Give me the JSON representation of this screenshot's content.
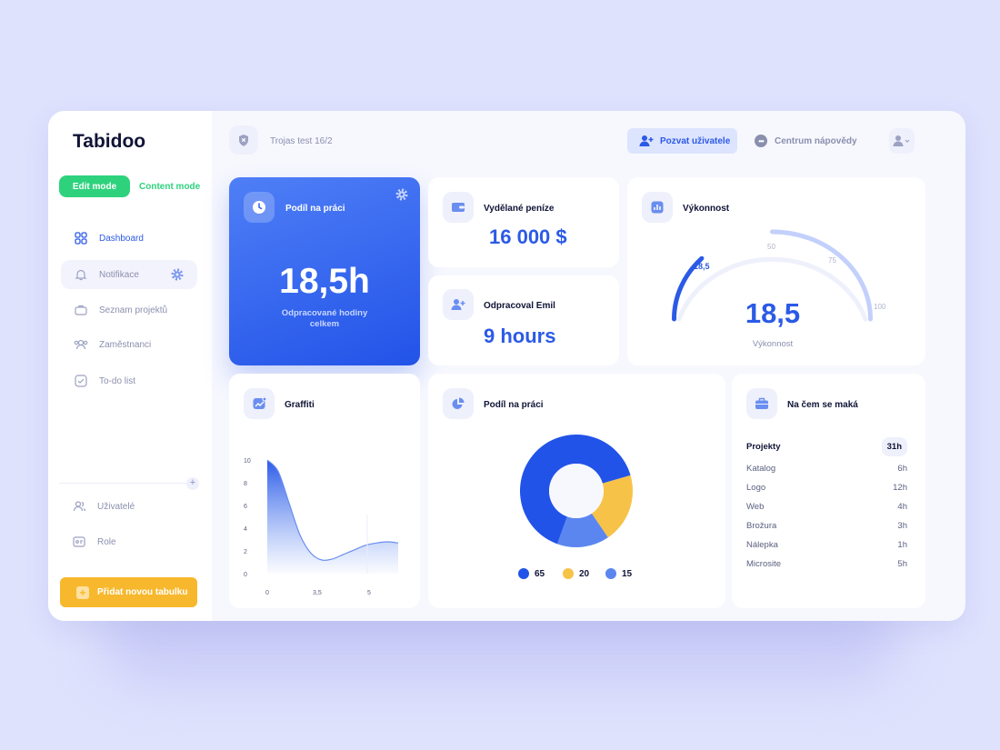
{
  "app": {
    "name": "Tabidoo"
  },
  "modes": {
    "edit": "Edit mode",
    "content": "Content mode"
  },
  "sidebar": {
    "items": [
      {
        "label": "Dashboard"
      },
      {
        "label": "Notifikace"
      },
      {
        "label": "Seznam projektů"
      },
      {
        "label": "Zaměstnanci"
      },
      {
        "label": "To-do list"
      }
    ],
    "bottom_items": [
      {
        "label": "Uživatelé"
      },
      {
        "label": "Role"
      }
    ],
    "add_table": "Přidat novou tabulku"
  },
  "topbar": {
    "workspace": "Trojas test 16/2",
    "invite": "Pozvat uživatele",
    "help": "Centrum nápovědy"
  },
  "cards": {
    "podil_hero": {
      "title": "Podíl na práci",
      "value": "18,5h",
      "subtitle": "Odpracované hodiny celkem"
    },
    "money": {
      "title": "Vydělané peníze",
      "value": "16 000 $"
    },
    "worked": {
      "title": "Odpracoval Emil",
      "value": "9 hours"
    },
    "performance": {
      "title": "Výkonnost",
      "value": "18,5",
      "label": "Výkonnost",
      "current": 18.5,
      "ticks": [
        "18,5",
        "50",
        "75",
        "100"
      ]
    },
    "graffiti": {
      "title": "Graffiti"
    },
    "share": {
      "title": "Podíl na práci"
    },
    "work": {
      "title": "Na čem se maká",
      "header": {
        "label": "Projekty",
        "value": "31h"
      },
      "rows": [
        {
          "label": "Katalog",
          "value": "6h"
        },
        {
          "label": "Logo",
          "value": "12h"
        },
        {
          "label": "Web",
          "value": "4h"
        },
        {
          "label": "Brožura",
          "value": "3h"
        },
        {
          "label": "Nálepka",
          "value": "1h"
        },
        {
          "label": "Microsite",
          "value": "5h"
        }
      ]
    }
  },
  "colors": {
    "blue": "#2253e8",
    "yellow": "#f7c248",
    "light_blue": "#5b86f0",
    "green": "#2ed27d",
    "orange": "#f7b82e"
  },
  "chart_data": [
    {
      "type": "area",
      "ylim": [
        0,
        10
      ],
      "yticks": [
        "0",
        "2",
        "4",
        "6",
        "8",
        "10"
      ],
      "xticks": [
        "0",
        "3,5",
        "5"
      ],
      "x": [
        0,
        0.5,
        1,
        1.5,
        2,
        2.5,
        3,
        3.5,
        4,
        4.5,
        5,
        5.5,
        6
      ],
      "y": [
        10,
        9,
        6.2,
        3.4,
        1.8,
        1.2,
        1.3,
        1.7,
        2.1,
        2.5,
        2.7,
        2.8,
        2.7
      ]
    },
    {
      "type": "pie",
      "slices": [
        {
          "label": "65",
          "value": 65,
          "color": "#2253e8"
        },
        {
          "label": "20",
          "value": 20,
          "color": "#f7c248"
        },
        {
          "label": "15",
          "value": 15,
          "color": "#5b86f0"
        }
      ]
    }
  ]
}
